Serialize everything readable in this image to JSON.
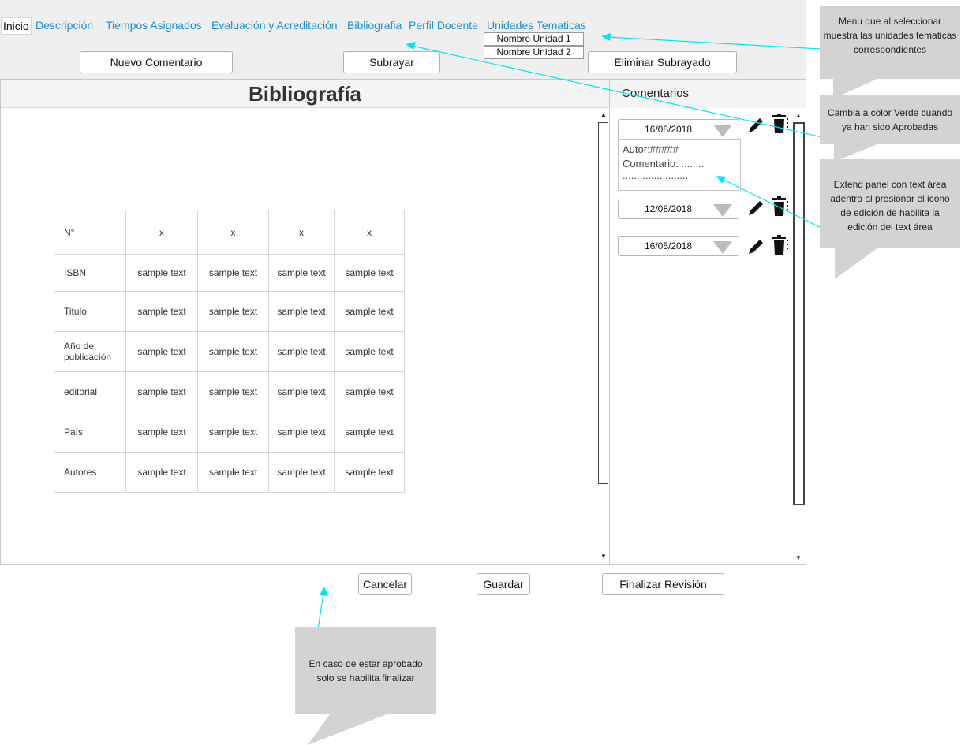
{
  "nav": {
    "items": [
      "Inicio",
      "Descripción",
      "Tiempos Asignados",
      "Evaluación y Acreditación",
      "Bibliografia",
      "Perfil Docente",
      "Unidades Tematicas"
    ],
    "unit_menu": [
      "Nombre Unidad 1",
      "Nombre Unidad 2"
    ]
  },
  "toolbar": {
    "new_comment": "Nuevo Comentario",
    "underline": "Subrayar",
    "remove_underline": "Eliminar Subrayado"
  },
  "main": {
    "title": "Bibliografía",
    "table": {
      "header": [
        "N°",
        "x",
        "x",
        "x",
        "x"
      ],
      "rows": [
        {
          "label": "ISBN",
          "cells": [
            "sample text",
            "sample text",
            "sample text",
            "sample text"
          ]
        },
        {
          "label": "Titulo",
          "cells": [
            "sample text",
            "sample text",
            "sample text",
            "sample text"
          ]
        },
        {
          "label": "Año de publicación",
          "cells": [
            "sample text",
            "sample text",
            "sample text",
            "sample text"
          ]
        },
        {
          "label": "editorial",
          "cells": [
            "sample text",
            "sample text",
            "sample text",
            "sample text"
          ]
        },
        {
          "label": "País",
          "cells": [
            "sample text",
            "sample text",
            "sample text",
            "sample text"
          ]
        },
        {
          "label": "Autores",
          "cells": [
            "sample text",
            "sample text",
            "sample text",
            "sample text"
          ]
        }
      ]
    }
  },
  "comments": {
    "title": "Comentarios",
    "items": [
      {
        "date": "16/08/2018"
      },
      {
        "date": "12/08/2018"
      },
      {
        "date": "16/05/2018"
      }
    ],
    "expanded": {
      "author": "Autor:#####",
      "comment": "Comentario: ........",
      "more": "......................."
    }
  },
  "footer": {
    "cancel": "Cancelar",
    "save": "Guardar",
    "finish": "Finalizar Revisión"
  },
  "annotations": {
    "menu_note": "Menu que al seleccionar muestra las unidades tematicas correspondientes",
    "green_note": "Cambia a color Verde cuando ya han sido Aprobadas",
    "extend_note": "Extend panel con text área adentro al presionar el icono de edición de habilita la edición del text área",
    "approved_note": "En caso de estar aprobado solo se habilita finalizar"
  },
  "colors": {
    "nav_link": "#1a8fd6",
    "arrow": "#00e5f0",
    "callout": "#d3d3d3",
    "panel_header": "#f4f4f4"
  }
}
